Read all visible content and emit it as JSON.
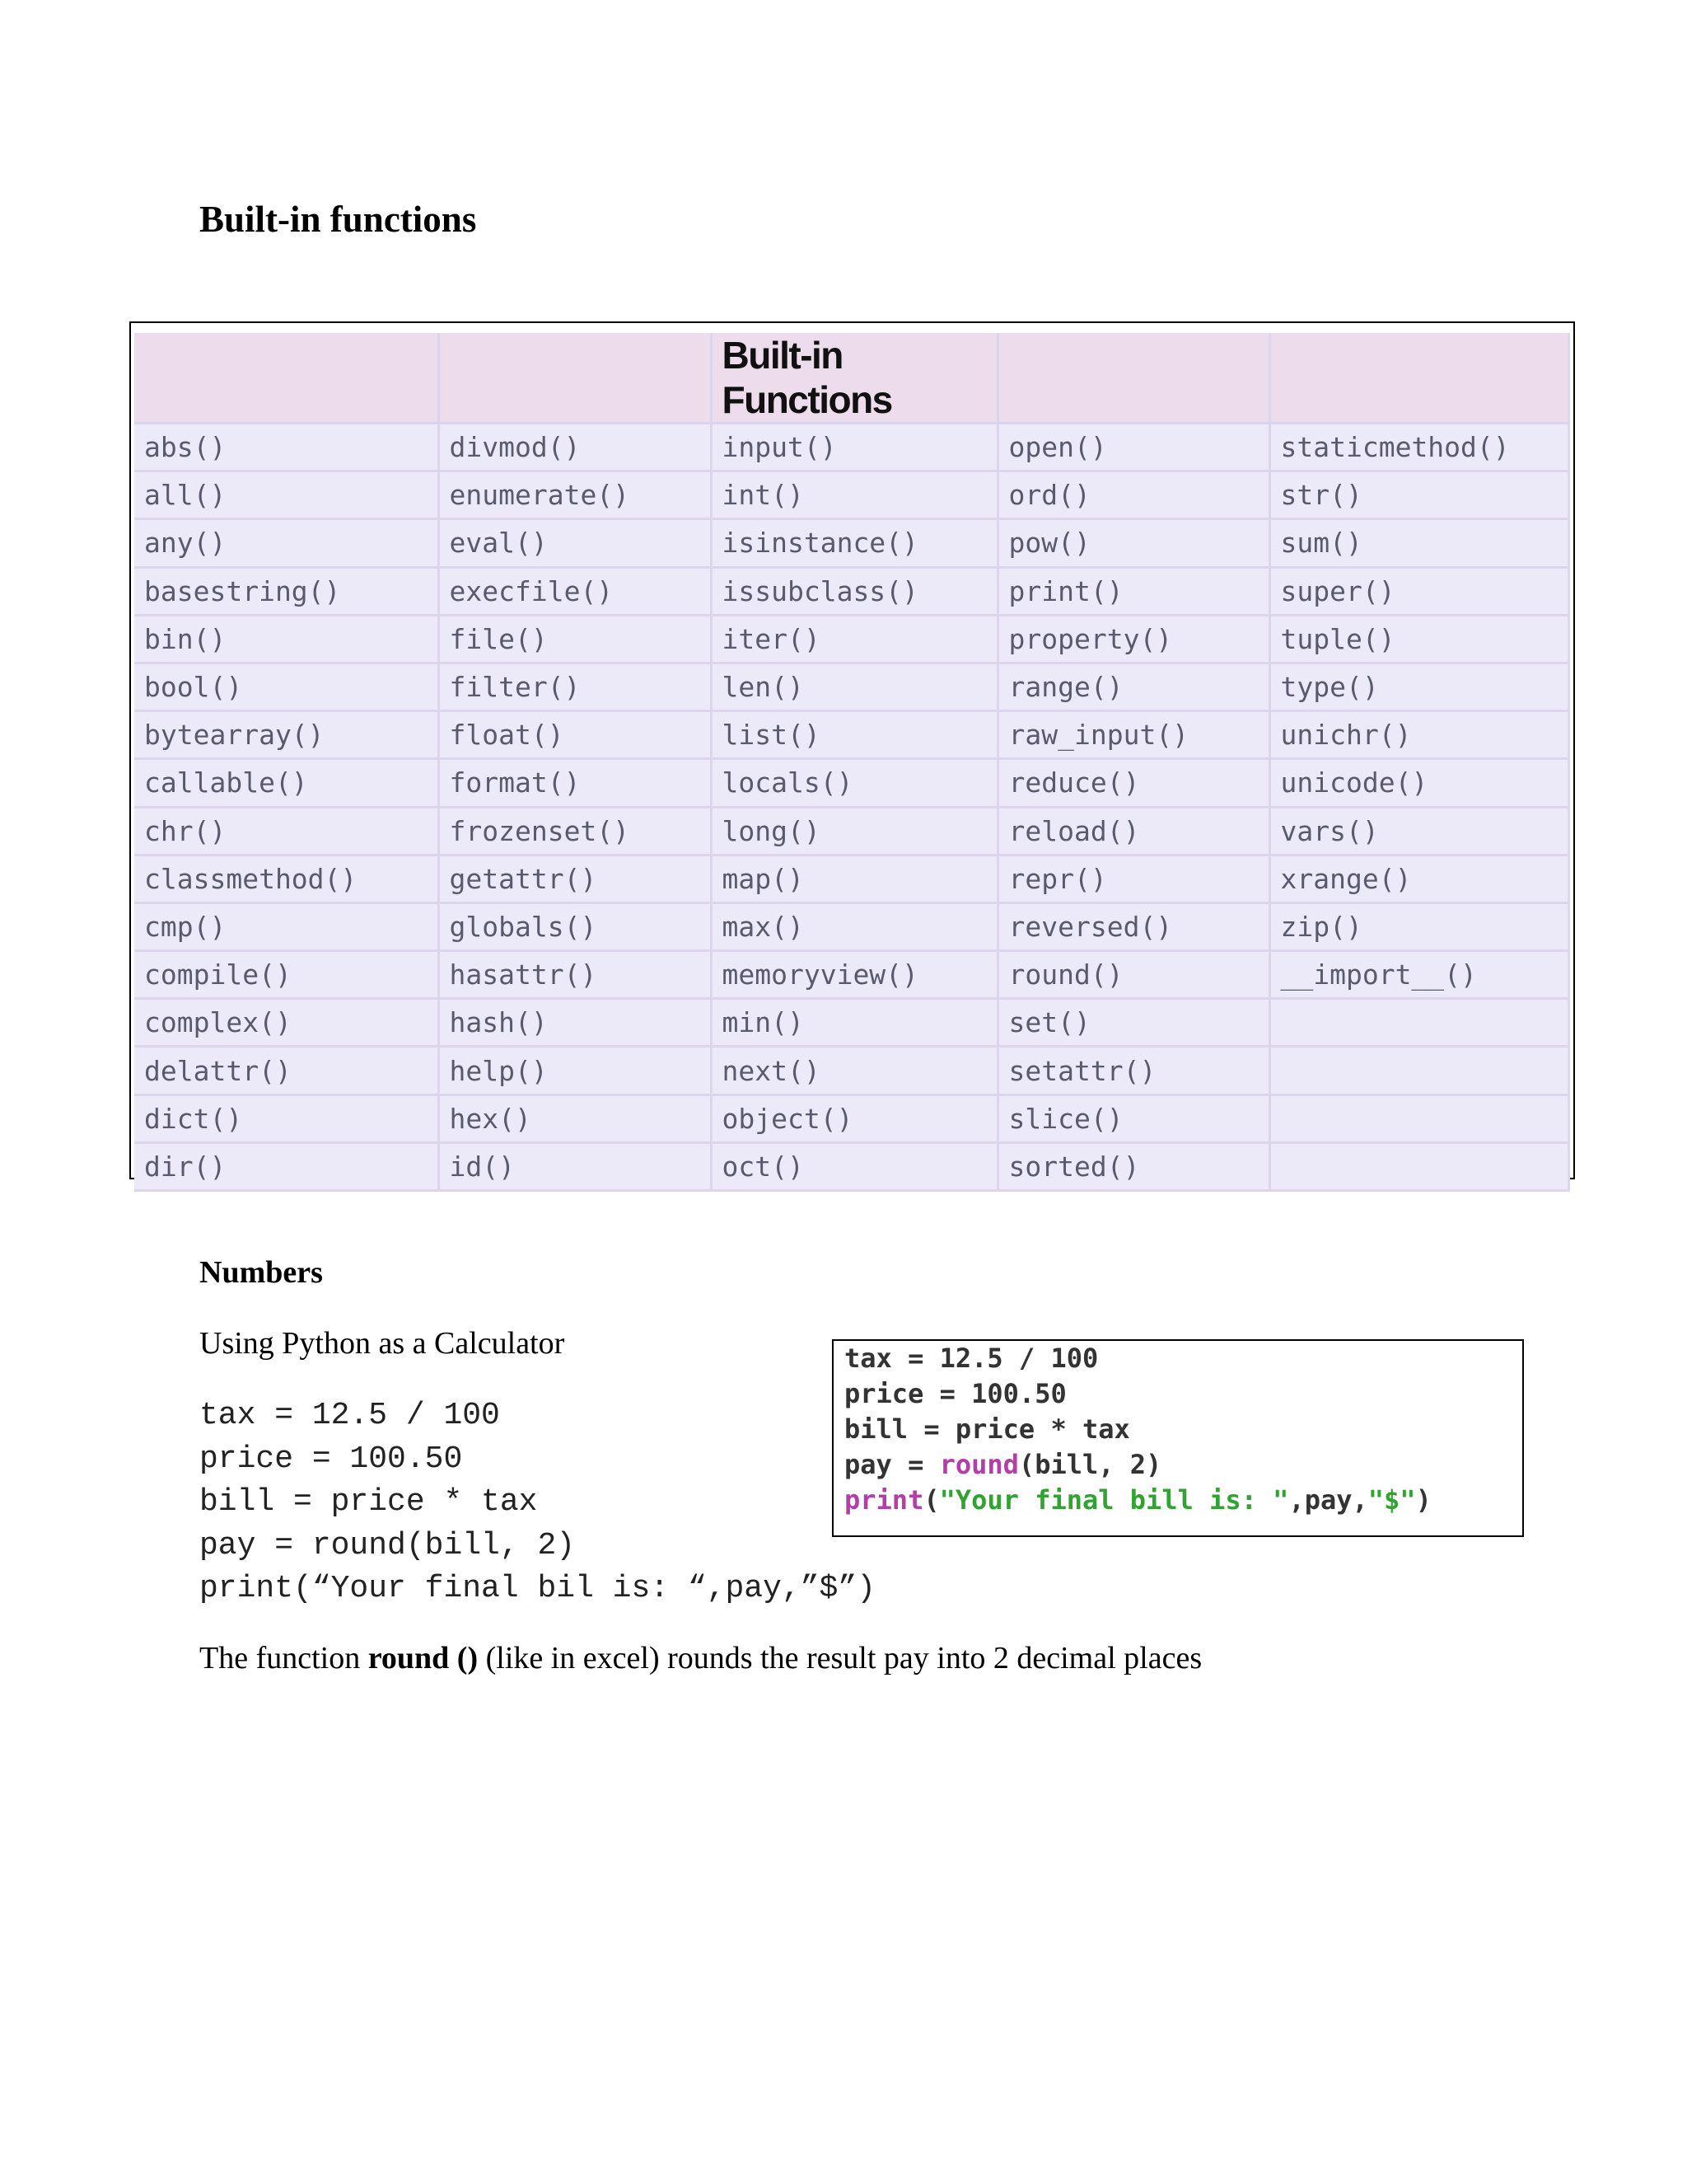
{
  "heading_builtin": "Built-in functions",
  "table": {
    "title": "Built-in Functions",
    "rows": [
      [
        "abs()",
        "divmod()",
        "input()",
        "open()",
        "staticmethod()"
      ],
      [
        "all()",
        "enumerate()",
        "int()",
        "ord()",
        "str()"
      ],
      [
        "any()",
        "eval()",
        "isinstance()",
        "pow()",
        "sum()"
      ],
      [
        "basestring()",
        "execfile()",
        "issubclass()",
        "print()",
        "super()"
      ],
      [
        "bin()",
        "file()",
        "iter()",
        "property()",
        "tuple()"
      ],
      [
        "bool()",
        "filter()",
        "len()",
        "range()",
        "type()"
      ],
      [
        "bytearray()",
        "float()",
        "list()",
        "raw_input()",
        "unichr()"
      ],
      [
        "callable()",
        "format()",
        "locals()",
        "reduce()",
        "unicode()"
      ],
      [
        "chr()",
        "frozenset()",
        "long()",
        "reload()",
        "vars()"
      ],
      [
        "classmethod()",
        "getattr()",
        "map()",
        "repr()",
        "xrange()"
      ],
      [
        "cmp()",
        "globals()",
        "max()",
        "reversed()",
        "zip()"
      ],
      [
        "compile()",
        "hasattr()",
        "memoryview()",
        "round()",
        "__import__()"
      ],
      [
        "complex()",
        "hash()",
        "min()",
        "set()",
        ""
      ],
      [
        "delattr()",
        "help()",
        "next()",
        "setattr()",
        ""
      ],
      [
        "dict()",
        "hex()",
        "object()",
        "slice()",
        ""
      ],
      [
        "dir()",
        "id()",
        "oct()",
        "sorted()",
        ""
      ]
    ]
  },
  "heading_numbers": "Numbers",
  "calc_subtitle": "Using Python as a Calculator",
  "code_lines": [
    "tax = 12.5 / 100",
    "price = 100.50",
    "bill = price * tax",
    "pay = round(bill, 2)",
    "print(“Your final bil is: “,pay,”$”)"
  ],
  "code_image": {
    "line1": "tax = 12.5 / 100",
    "line2": "price = 100.50",
    "line3": "bill = price * tax",
    "line4_pre": "pay = ",
    "line4_kw": "round",
    "line4_post": "(bill, 2)",
    "line5_kw": "print",
    "line5_open": "(",
    "line5_str": "\"Your final bill is: \"",
    "line5_mid": ",pay,",
    "line5_str2": "\"$\"",
    "line5_close": ")"
  },
  "round_note": {
    "pre": "The function ",
    "bold": "round ()",
    "post": " (like in excel) rounds the result pay into 2 decimal places"
  }
}
